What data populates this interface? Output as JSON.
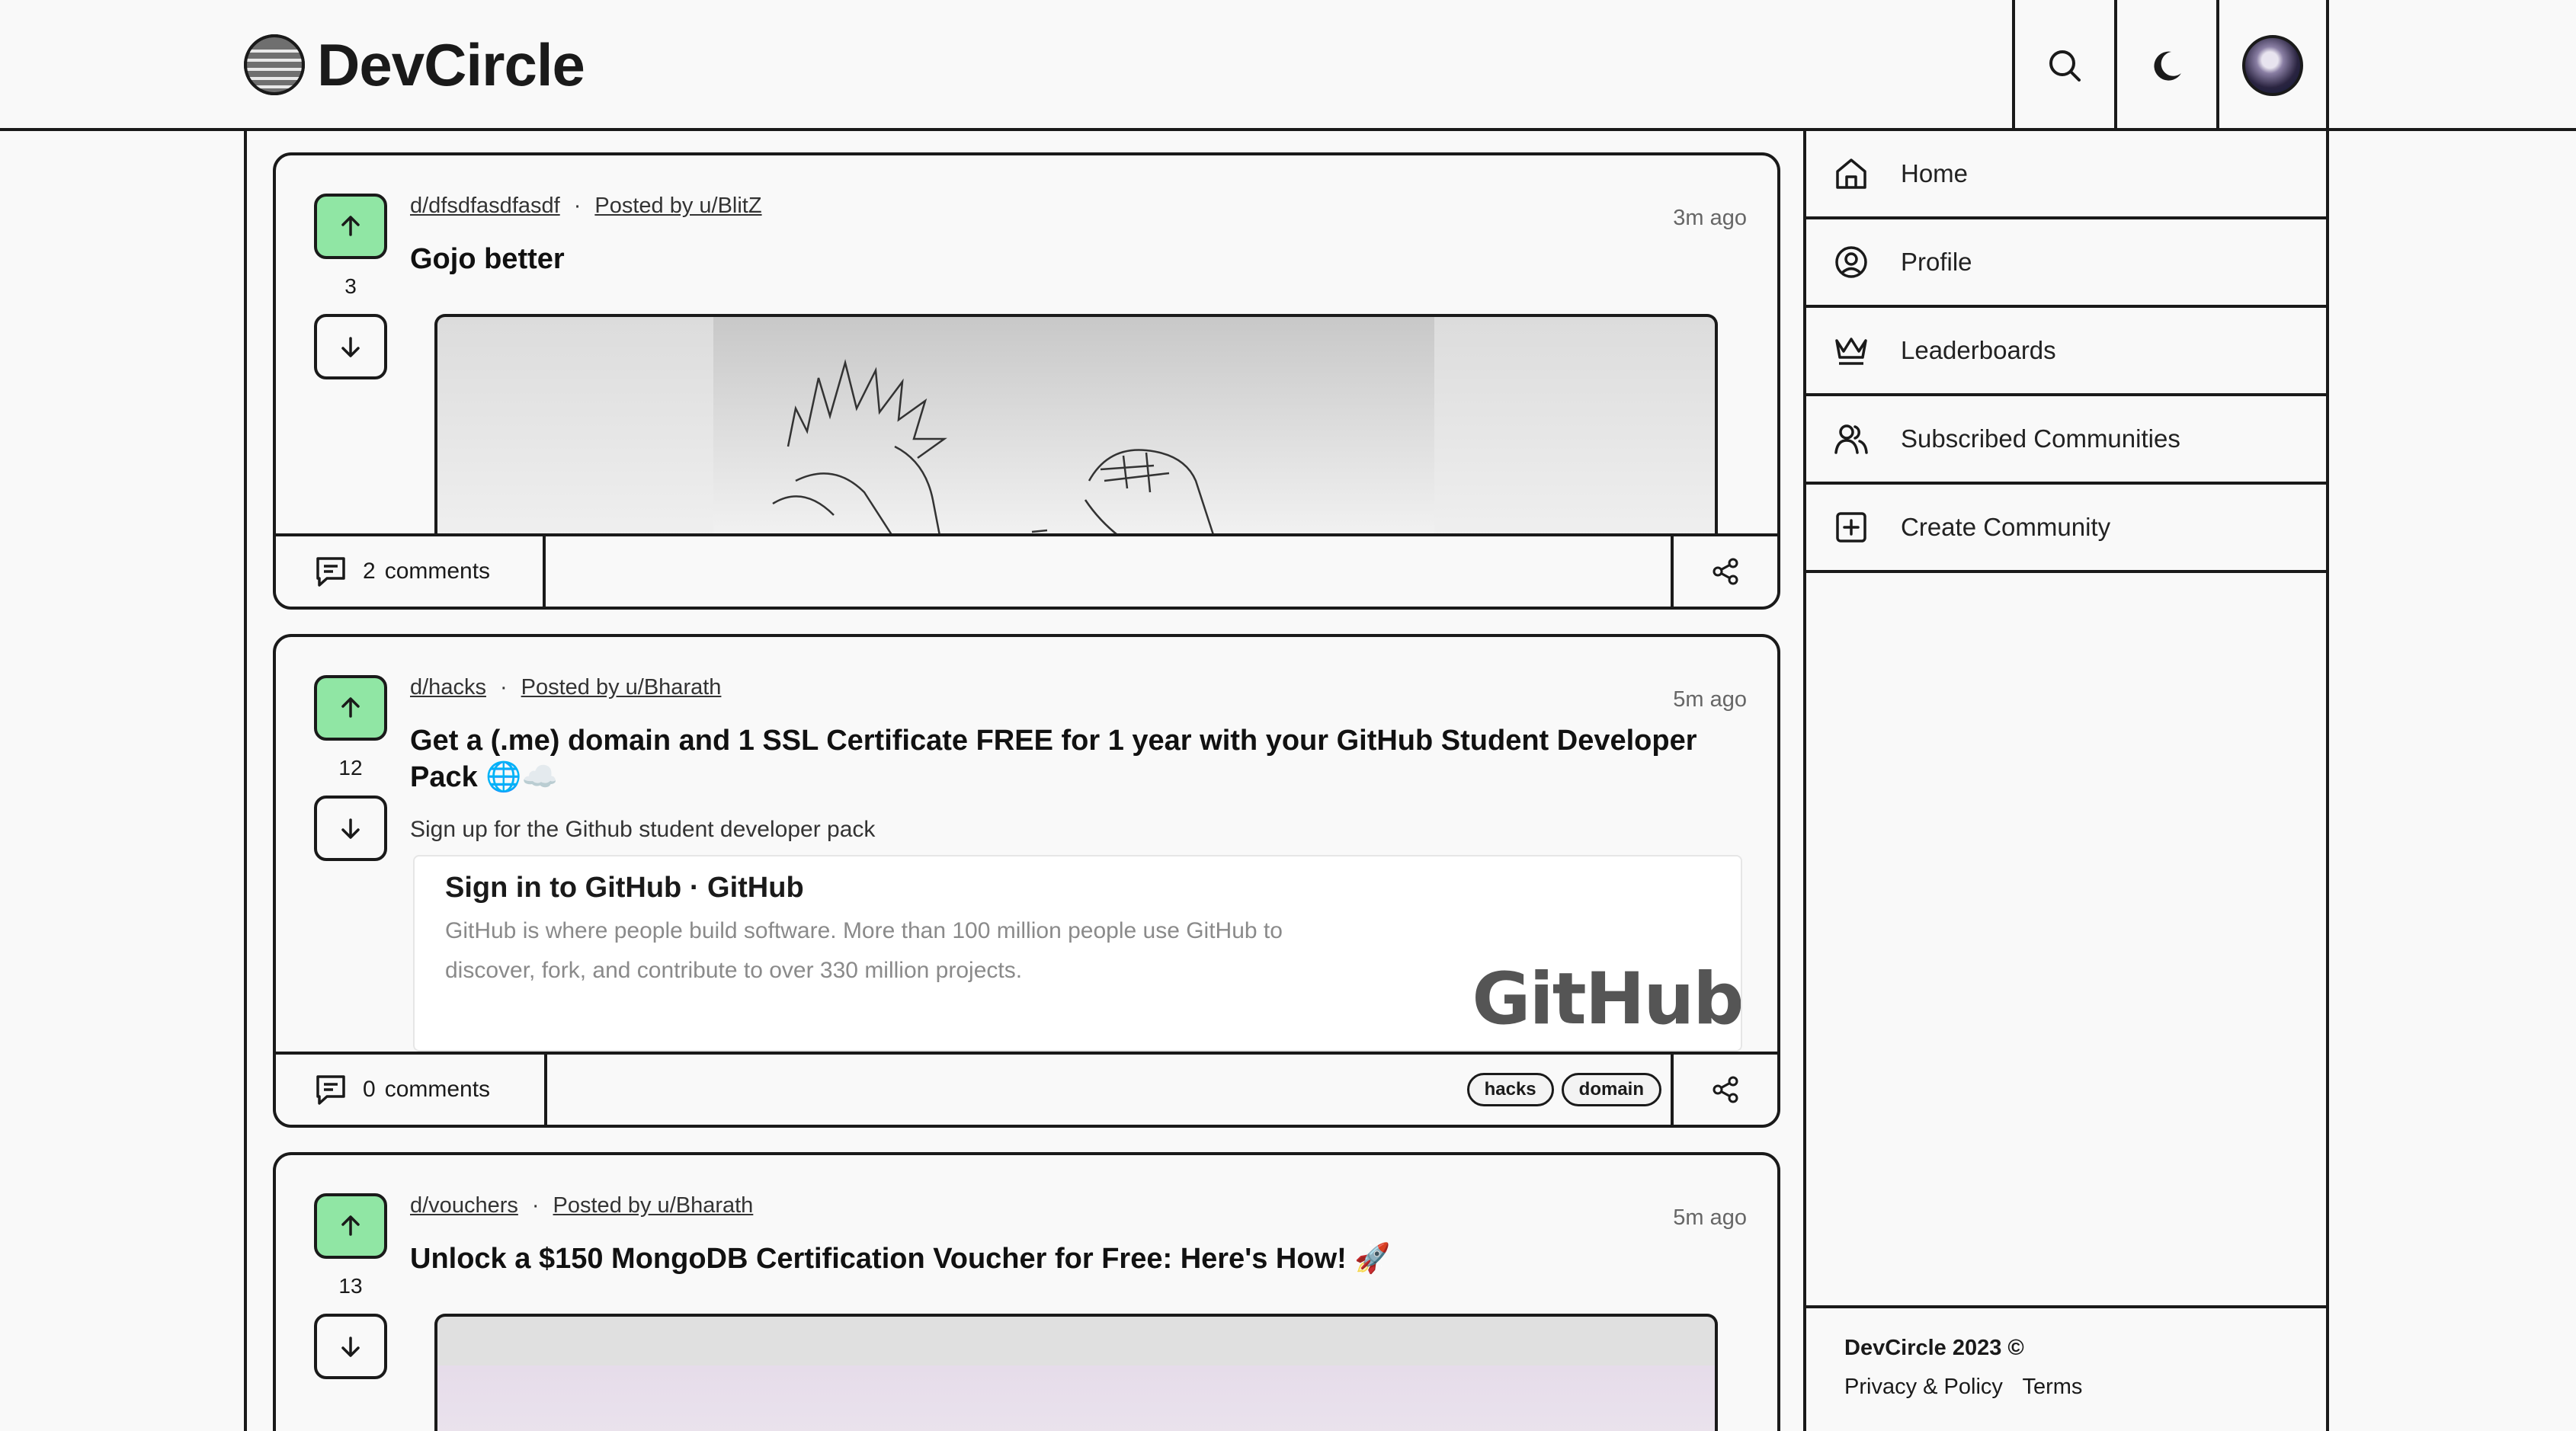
{
  "app": {
    "name": "DevCircle"
  },
  "header": {
    "search_icon": "search-icon",
    "theme_icon": "moon-icon",
    "avatar": "avatar"
  },
  "posts": [
    {
      "community": "d/dfsdfasdfasdf",
      "posted_by": "Posted by u/BlitZ",
      "time": "3m ago",
      "title": "Gojo better",
      "votes": "3",
      "comments_count": "2",
      "comments_label": "comments"
    },
    {
      "community": "d/hacks",
      "posted_by": "Posted by u/Bharath",
      "time": "5m ago",
      "title_line1": "Get a (.me) domain and 1 SSL Certificate FREE for 1 year with your GitHub Student Developer",
      "title_line2": "Pack 🌐☁️",
      "description": "Sign up for the Github student developer pack",
      "votes": "12",
      "comments_count": "0",
      "comments_label": "comments",
      "preview": {
        "title": "Sign in to GitHub · GitHub",
        "desc_line1": "GitHub is where people build software. More than 100 million people use GitHub to",
        "desc_line2": "discover, fork, and contribute to over 330 million projects.",
        "logo_text": "GitHub"
      },
      "tags": [
        "hacks",
        "domain"
      ]
    },
    {
      "community": "d/vouchers",
      "posted_by": "Posted by u/Bharath",
      "time": "5m ago",
      "title": "Unlock a $150 MongoDB Certification Voucher for Free: Here's How! 🚀",
      "votes": "13"
    }
  ],
  "sidebar": {
    "items": [
      {
        "label": "Home",
        "icon": "home-icon"
      },
      {
        "label": "Profile",
        "icon": "user-circle-icon"
      },
      {
        "label": "Leaderboards",
        "icon": "crown-icon"
      },
      {
        "label": "Subscribed Communities",
        "icon": "users-icon"
      },
      {
        "label": "Create Community",
        "icon": "plus-square-icon"
      }
    ],
    "copyright": "DevCircle 2023 ©",
    "links": [
      "Privacy & Policy",
      "Terms"
    ]
  }
}
